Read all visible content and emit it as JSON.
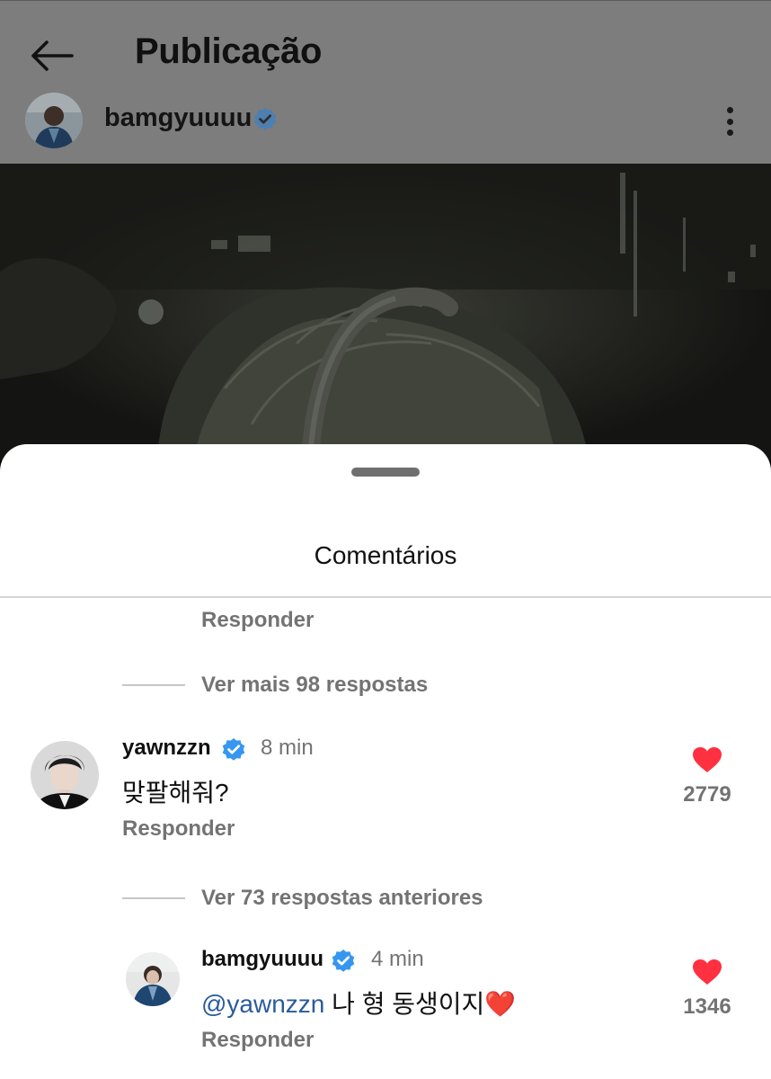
{
  "header": {
    "title": "Publicação",
    "back_icon": "arrow-left-icon"
  },
  "post": {
    "username": "bamgyuuuu",
    "verified": true,
    "more_icon": "more-vertical-icon"
  },
  "comments_sheet": {
    "title": "Comentários",
    "top_reply_label": "Responder",
    "more_replies_1": "Ver mais 98 respostas",
    "comment_1": {
      "username": "yawnzzn",
      "time": "8 min",
      "text": "맞팔해줘?",
      "likes": "2779",
      "reply_label": "Responder"
    },
    "previous_replies": "Ver 73 respostas anteriores",
    "comment_2": {
      "username": "bamgyuuuu",
      "time": "4 min",
      "mention": "@yawnzzn",
      "text": " 나 형 동생이지",
      "emoji": "❤️",
      "likes": "1346",
      "reply_label": "Responder"
    }
  },
  "colors": {
    "verified_blue": "#3797f0",
    "like_red": "#ff3040",
    "mention_blue": "#2a5b9c",
    "secondary_text": "#737373"
  }
}
